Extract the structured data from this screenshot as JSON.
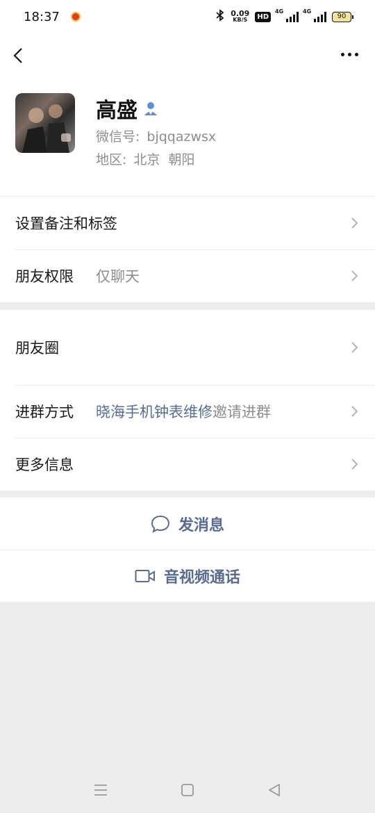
{
  "status_bar": {
    "time": "18:37",
    "net_speed_value": "0.09",
    "net_speed_unit": "KB/S",
    "hd_badge": "HD",
    "sim1_label": "4G",
    "sim2_label": "4G",
    "battery": "90"
  },
  "profile": {
    "name": "高盛",
    "wechat_id_label": "微信号:",
    "wechat_id": "bjqqazwsx",
    "region_label": "地区:",
    "region": "北京  朝阳"
  },
  "cells_group1": [
    {
      "label": "设置备注和标签",
      "value": ""
    },
    {
      "label": "朋友权限",
      "value": "仅聊天"
    }
  ],
  "cells_group2": [
    {
      "label": "朋友圈",
      "value": ""
    },
    {
      "label": "进群方式",
      "value_link": "晓海手机钟表维修",
      "value_suffix": "邀请进群"
    },
    {
      "label": "更多信息",
      "value": ""
    }
  ],
  "actions": {
    "send_message": "发消息",
    "av_call": "音视频通话"
  },
  "colors": {
    "link": "#576b95",
    "background": "#ededed",
    "text_secondary": "#8d8d8d"
  },
  "icons": [
    "back-icon",
    "more-icon",
    "person-tag-icon",
    "chevron-right-icon",
    "chat-bubble-icon",
    "video-camera-icon",
    "menu-key-icon",
    "home-key-icon",
    "back-key-icon"
  ]
}
